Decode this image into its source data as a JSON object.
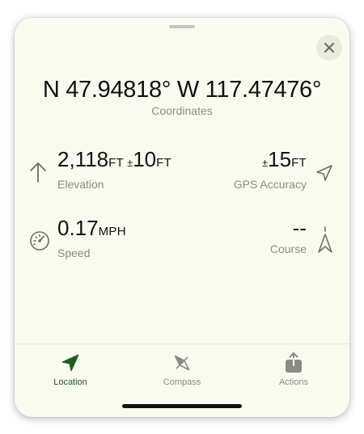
{
  "coordinates": {
    "value": "N 47.94818° W 117.47476°",
    "label": "Coordinates"
  },
  "elevation": {
    "value": "2,118",
    "unit": "FT",
    "accuracy_prefix": "±",
    "accuracy_value": "10",
    "accuracy_unit": "FT",
    "label": "Elevation"
  },
  "gps_accuracy": {
    "prefix": "±",
    "value": "15",
    "unit": "FT",
    "label": "GPS Accuracy"
  },
  "speed": {
    "value": "0.17",
    "unit": "MPH",
    "label": "Speed"
  },
  "course": {
    "value": "--",
    "label": "Course"
  },
  "tabs": [
    {
      "label": "Location",
      "icon": "location-arrow-icon",
      "active": true
    },
    {
      "label": "Compass",
      "icon": "compass-icon",
      "active": false
    },
    {
      "label": "Actions",
      "icon": "share-icon",
      "active": false
    }
  ],
  "colors": {
    "sheet_background": "#fafbf0",
    "accent": "#1e5c23",
    "secondary_text": "#8a8b85"
  }
}
